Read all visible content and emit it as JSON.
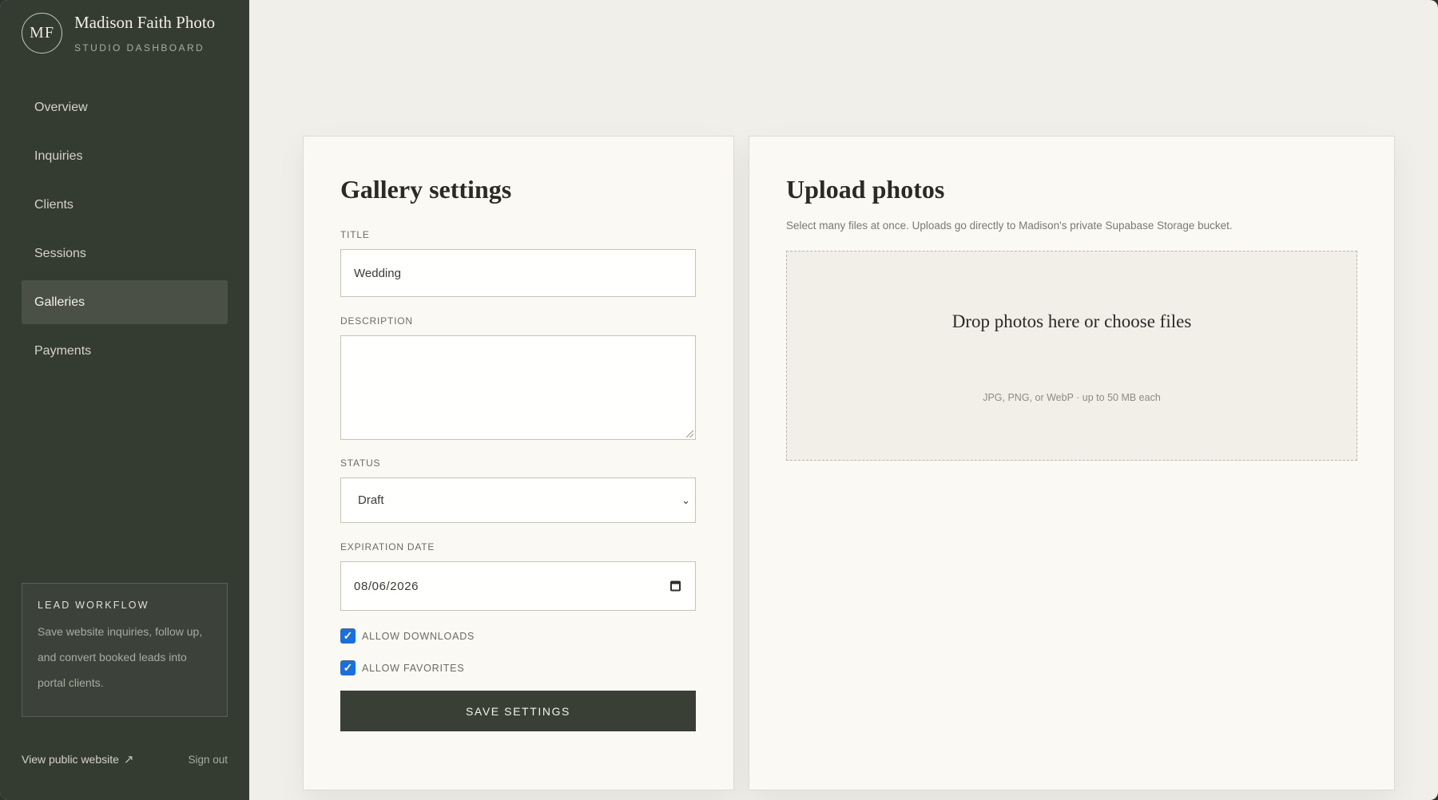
{
  "brand": {
    "monogram": "MF",
    "name": "Madison Faith Photo",
    "subtitle": "STUDIO DASHBOARD"
  },
  "nav": {
    "items": [
      {
        "label": "Overview",
        "active": false
      },
      {
        "label": "Inquiries",
        "active": false
      },
      {
        "label": "Clients",
        "active": false
      },
      {
        "label": "Sessions",
        "active": false
      },
      {
        "label": "Galleries",
        "active": true
      },
      {
        "label": "Payments",
        "active": false
      }
    ]
  },
  "lead_workflow": {
    "title": "LEAD WORKFLOW",
    "text": "Save website inquiries, follow up, and convert booked leads into portal clients."
  },
  "footer": {
    "view_website": "View public website",
    "view_website_icon": "external-arrow-icon",
    "sign_out": "Sign out"
  },
  "gallery_settings": {
    "title": "Gallery settings",
    "title_label": "TITLE",
    "title_value": "Wedding",
    "description_label": "DESCRIPTION",
    "description_value": "",
    "status_label": "STATUS",
    "status_value": "Draft",
    "expiration_label": "EXPIRATION DATE",
    "expiration_value": "08/06/2026",
    "allow_downloads_label": "ALLOW DOWNLOADS",
    "allow_downloads": true,
    "allow_favorites_label": "ALLOW FAVORITES",
    "allow_favorites": true,
    "save_label": "SAVE SETTINGS"
  },
  "upload": {
    "title": "Upload photos",
    "description": "Select many files at once. Uploads go directly to Madison's private Supabase Storage bucket.",
    "drop_title": "Drop photos here or choose files",
    "drop_hint": "JPG, PNG, or WebP · up to 50 MB each"
  },
  "colors": {
    "sidebar": "#343b31",
    "accent_button": "#393f35",
    "checkbox": "#1a6fe0",
    "background": "#f1efe9"
  }
}
